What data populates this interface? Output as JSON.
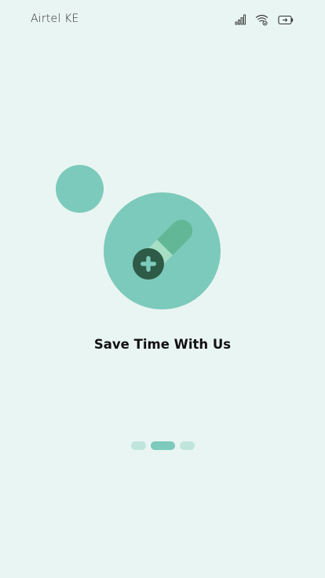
{
  "status_bar": {
    "carrier": "Airtel KE",
    "icons": [
      "signal-icon",
      "wifi-icon",
      "battery-icon"
    ]
  },
  "onboarding": {
    "illustration_icon": "pill-plus-icon",
    "title": "Save Time With Us",
    "page_indicator": {
      "total": 3,
      "active_index": 1
    }
  },
  "colors": {
    "background": "#e9f5f2",
    "accent": "#7ccabb",
    "accent_light": "#bfe5dd",
    "dark_green": "#2e5a48"
  }
}
